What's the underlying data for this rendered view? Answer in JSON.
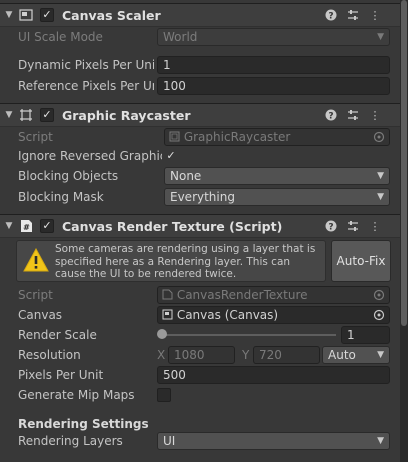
{
  "canvas_scaler": {
    "title": "Canvas Scaler",
    "ui_scale_mode": {
      "label": "UI Scale Mode",
      "value": "World"
    },
    "dynamic_pixels": {
      "label": "Dynamic Pixels Per Unit",
      "value": "1"
    },
    "reference_pixels": {
      "label": "Reference Pixels Per Unit",
      "value": "100"
    }
  },
  "graphic_raycaster": {
    "title": "Graphic Raycaster",
    "script": {
      "label": "Script",
      "value": "GraphicRaycaster"
    },
    "ignore_reversed": {
      "label": "Ignore Reversed Graphics",
      "checked": true
    },
    "blocking_objects": {
      "label": "Blocking Objects",
      "value": "None"
    },
    "blocking_mask": {
      "label": "Blocking Mask",
      "value": "Everything"
    }
  },
  "canvas_render_texture": {
    "title": "Canvas Render Texture (Script)",
    "warning": "Some cameras are rendering using a layer that is specified here as a Rendering layer. This can cause the UI to be rendered twice.",
    "autofix_label": "Auto-Fix",
    "script": {
      "label": "Script",
      "value": "CanvasRenderTexture"
    },
    "canvas": {
      "label": "Canvas",
      "value": "Canvas (Canvas)"
    },
    "render_scale": {
      "label": "Render Scale",
      "value": "1"
    },
    "resolution": {
      "label": "Resolution",
      "x_label": "X",
      "x_value": "1080",
      "y_label": "Y",
      "y_value": "720",
      "mode": "Auto"
    },
    "pixels_per_unit": {
      "label": "Pixels Per Unit",
      "value": "500"
    },
    "generate_mipmaps": {
      "label": "Generate Mip Maps",
      "checked": false
    },
    "rendering_settings_title": "Rendering Settings",
    "rendering_layers": {
      "label": "Rendering Layers",
      "value": "UI"
    }
  },
  "icons": {
    "help": "help-icon",
    "presets": "presets-icon",
    "menu": "kebab-menu-icon",
    "warning": "warning-icon",
    "target": "object-picker-icon"
  },
  "colors": {
    "background": "#383838",
    "field": "#2a2a2a",
    "header": "#3e3e3e",
    "warning": "#f0c419"
  }
}
